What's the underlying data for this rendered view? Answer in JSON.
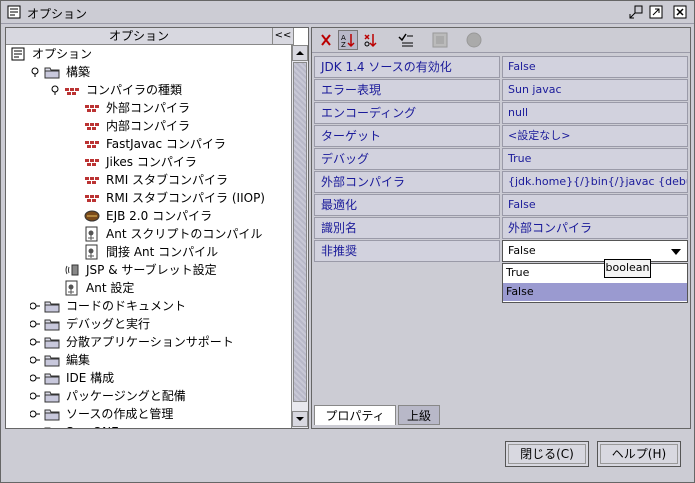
{
  "window": {
    "title": "オプション"
  },
  "tree": {
    "header": "オプション",
    "collapse_label": "<<",
    "nodes": [
      {
        "label": "オプション",
        "icon": "options-icon"
      },
      {
        "label": "構築",
        "icon": "folder-icon"
      },
      {
        "label": "コンパイラの種類",
        "icon": "compiler-group-icon"
      },
      {
        "label": "外部コンパイラ",
        "icon": "compiler-icon"
      },
      {
        "label": "内部コンパイラ",
        "icon": "compiler-icon"
      },
      {
        "label": "FastJavac コンパイラ",
        "icon": "compiler-icon"
      },
      {
        "label": "Jikes コンパイラ",
        "icon": "compiler-icon"
      },
      {
        "label": "RMI スタブコンパイラ",
        "icon": "compiler-icon"
      },
      {
        "label": "RMI スタブコンパイラ (IIOP)",
        "icon": "compiler-icon"
      },
      {
        "label": "EJB 2.0 コンパイラ",
        "icon": "ejb-icon"
      },
      {
        "label": "Ant スクリプトのコンパイル",
        "icon": "ant-icon"
      },
      {
        "label": "間接 Ant コンパイル",
        "icon": "ant-icon"
      },
      {
        "label": "JSP & サーブレット設定",
        "icon": "jsp-icon"
      },
      {
        "label": "Ant 設定",
        "icon": "ant-icon"
      },
      {
        "label": "コードのドキュメント",
        "icon": "folder-icon"
      },
      {
        "label": "デバッグと実行",
        "icon": "folder-icon"
      },
      {
        "label": "分散アプリケーションサポート",
        "icon": "folder-icon"
      },
      {
        "label": "編集",
        "icon": "folder-icon"
      },
      {
        "label": "IDE 構成",
        "icon": "folder-icon"
      },
      {
        "label": "パッケージングと配備",
        "icon": "folder-icon"
      },
      {
        "label": "ソースの作成と管理",
        "icon": "folder-icon"
      },
      {
        "label": "Sun ONE",
        "icon": "folder-icon"
      }
    ]
  },
  "properties": [
    {
      "name": "JDK 1.4 ソースの有効化",
      "value": "False"
    },
    {
      "name": "エラー表現",
      "value": "Sun javac"
    },
    {
      "name": "エンコーディング",
      "value": "null"
    },
    {
      "name": "ターゲット",
      "value": "<設定なし>"
    },
    {
      "name": "デバッグ",
      "value": "True"
    },
    {
      "name": "外部コンパイラ",
      "value": "{jdk.home}{/}bin{/}javac {debuginfo} {"
    },
    {
      "name": "最適化",
      "value": "False"
    },
    {
      "name": "識別名",
      "value": "外部コンパイラ"
    },
    {
      "name": "非推奨",
      "value": "False"
    }
  ],
  "dropdown": {
    "options": [
      "True",
      "False"
    ],
    "selected": "False"
  },
  "tooltip": "boolean",
  "tabs": [
    "プロパティ",
    "上級"
  ],
  "buttons": {
    "close": "閉じる(C)",
    "help": "ヘルプ(H)"
  },
  "colors": {
    "background": "#ccccd4",
    "property_text": "#1a1a9a",
    "selection": "#9a9ad0"
  }
}
